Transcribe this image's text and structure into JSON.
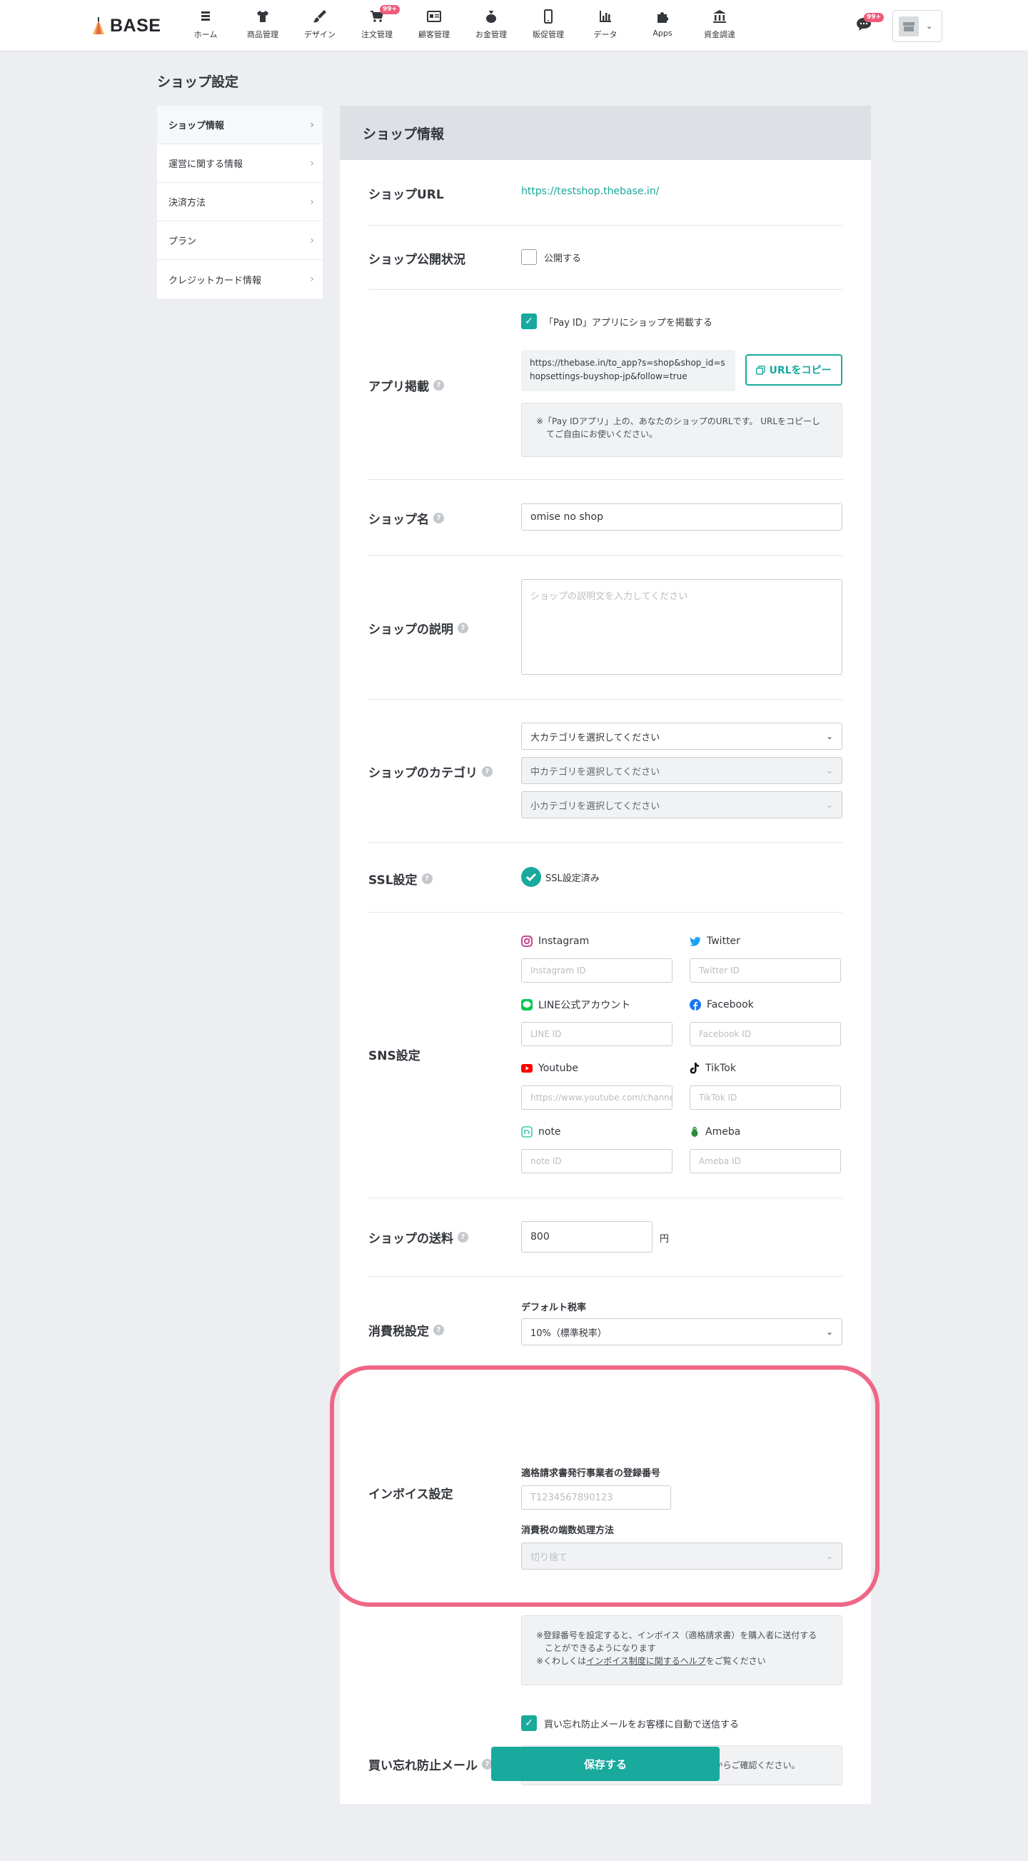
{
  "brand": {
    "logo_text": "BASE",
    "accent": "#19a99d",
    "highlight": "#ef6786",
    "badge": "#ef5b78"
  },
  "nav": {
    "items": [
      {
        "label": "ホーム",
        "icon": "list-icon"
      },
      {
        "label": "商品管理",
        "icon": "shirt-icon"
      },
      {
        "label": "デザイン",
        "icon": "brush-icon"
      },
      {
        "label": "注文管理",
        "icon": "cart-icon",
        "badge": "99+"
      },
      {
        "label": "顧客管理",
        "icon": "id-card-icon"
      },
      {
        "label": "お金管理",
        "icon": "money-bag-icon"
      },
      {
        "label": "販促管理",
        "icon": "phone-icon"
      },
      {
        "label": "データ",
        "icon": "bar-chart-icon"
      },
      {
        "label": "Apps",
        "icon": "puzzle-icon"
      },
      {
        "label": "資金調達",
        "icon": "bank-icon"
      }
    ],
    "chat_badge": "99+"
  },
  "page": {
    "title": "ショップ設定"
  },
  "sidemenu": {
    "items": [
      {
        "label": "ショップ情報"
      },
      {
        "label": "運営に関する情報"
      },
      {
        "label": "決済方法"
      },
      {
        "label": "プラン"
      },
      {
        "label": "クレジットカード情報"
      }
    ]
  },
  "panel": {
    "title": "ショップ情報"
  },
  "shop_url": {
    "label": "ショップURL",
    "value": "https://testshop.thebase.in/"
  },
  "visibility": {
    "label": "ショップ公開状況",
    "checkbox_label": "公開する",
    "checked": false
  },
  "app_listing": {
    "label": "アプリ掲載",
    "checkbox_label": "「Pay ID」アプリにショップを掲載する",
    "checked": true,
    "url_line1": "https://thebase.in/to_app?s=shop&shop_id=s",
    "url_line2": "hopsettings-buyshop-jp&follow=true",
    "copy_button": "URLをコピー",
    "note_line1": "※「Pay IDアプリ」上の、あなたのショップのURLです。 URLをコピーし",
    "note_line2": "てご自由にお使いください。"
  },
  "shop_name": {
    "label": "ショップ名",
    "value": "omise no shop"
  },
  "description": {
    "label": "ショップの説明",
    "placeholder": "ショップの説明文を入力してください"
  },
  "category": {
    "label": "ショップのカテゴリ",
    "large": "大カテゴリを選択してください",
    "medium": "中カテゴリを選択してください",
    "small": "小カテゴリを選択してください"
  },
  "ssl": {
    "label": "SSL設定",
    "status": "SSL設定済み"
  },
  "sns": {
    "label": "SNS設定",
    "items": [
      {
        "name": "Instagram",
        "placeholder": "Instagram ID",
        "icon": "instagram-icon",
        "color": "#c13584"
      },
      {
        "name": "Twitter",
        "placeholder": "Twitter ID",
        "icon": "twitter-icon",
        "color": "#1da1f2"
      },
      {
        "name": "LINE公式アカウント",
        "placeholder": "LINE ID",
        "icon": "line-icon",
        "color": "#06c755"
      },
      {
        "name": "Facebook",
        "placeholder": "Facebook ID",
        "icon": "facebook-icon",
        "color": "#1877f2"
      },
      {
        "name": "Youtube",
        "placeholder": "https://www.youtube.com/channel/UC",
        "icon": "youtube-icon",
        "color": "#ff0000"
      },
      {
        "name": "TikTok",
        "placeholder": "TikTok ID",
        "icon": "tiktok-icon",
        "color": "#111111"
      },
      {
        "name": "note",
        "placeholder": "note ID",
        "icon": "note-icon",
        "color": "#41c9b4"
      },
      {
        "name": "Ameba",
        "placeholder": "Ameba ID",
        "icon": "ameba-icon",
        "color": "#2d8c3c"
      }
    ]
  },
  "shipping": {
    "label": "ショップの送料",
    "value": "800",
    "unit": "円"
  },
  "tax": {
    "label": "消費税設定",
    "sub_label": "デフォルト税率",
    "value": "10%（標準税率）"
  },
  "invoice": {
    "label": "インボイス設定",
    "reg_label": "適格請求書発行事業者の登録番号",
    "reg_placeholder": "T1234567890123",
    "rounding_label": "消費税の端数処理方法",
    "rounding_value": "切り捨て",
    "note_line1": "※登録番号を設定すると、インボイス（適格請求書）を購入者に送付する",
    "note_line2": "ことができるようになります",
    "note_line3_prefix": "※くわしくは",
    "note_line3_link": "インボイス制度に関するヘルプ",
    "note_line3_suffix": "をご覧ください"
  },
  "reminder": {
    "label": "買い忘れ防止メール",
    "checkbox_label": "買い忘れ防止メールをお客様に自動で送信する",
    "checked": true,
    "note": "※送信されるメールの内容については、こちらからご確認ください。"
  },
  "save_button": "保存する"
}
